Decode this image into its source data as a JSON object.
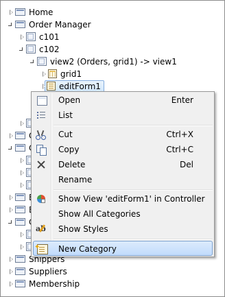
{
  "tree": {
    "home": "Home",
    "order_manager": "Order Manager",
    "c101": "c101",
    "c102": "c102",
    "view2": "view2 (Orders, grid1) -> view1",
    "grid1": "grid1",
    "editForm1": "editForm1",
    "obscured_c1": "C",
    "obscured_c2": "C",
    "obscured_e": "E",
    "obscured_e2": "E",
    "obscured_c3": "C",
    "shippers": "Shippers",
    "suppliers": "Suppliers",
    "membership": "Membership"
  },
  "menu": {
    "open": {
      "label": "Open",
      "shortcut": "Enter",
      "icon": "open-page-icon"
    },
    "list": {
      "label": "List",
      "icon": "list-icon"
    },
    "cut": {
      "label": "Cut",
      "shortcut": "Ctrl+X",
      "icon": "scissors-icon"
    },
    "copy": {
      "label": "Copy",
      "shortcut": "Ctrl+C",
      "icon": "copy-icon"
    },
    "delete": {
      "label": "Delete",
      "shortcut": "Del",
      "icon": "delete-x-icon"
    },
    "rename": {
      "label": "Rename"
    },
    "show_view": {
      "label": "Show View 'editForm1' in Controller",
      "icon": "show-view-icon"
    },
    "show_all_categories": {
      "label": "Show All Categories"
    },
    "show_styles": {
      "label": "Show Styles",
      "icon": "styles-icon"
    },
    "new_category": {
      "label": "New Category",
      "icon": "new-category-icon"
    }
  },
  "colors": {
    "menu_bg": "#f0f0f0",
    "highlight_border": "#7da2ce",
    "selection_border": "#84acdd"
  }
}
